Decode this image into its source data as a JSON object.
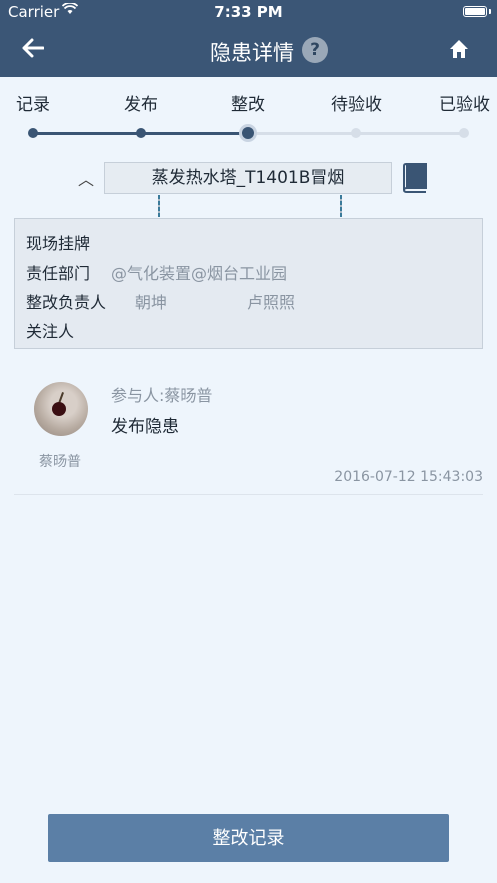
{
  "status_bar": {
    "carrier": "Carrier",
    "time": "7:33 PM"
  },
  "nav": {
    "title": "隐患详情",
    "help_label": "?"
  },
  "progress": {
    "steps": [
      "记录",
      "发布",
      "整改",
      "待验收",
      "已验收"
    ],
    "current_index": 2
  },
  "device": {
    "name": "蒸发热水塔_T1401B冒烟"
  },
  "info": {
    "site_tag_label": "现场挂牌",
    "dept_label": "责任部门",
    "dept_value": "@气化装置@烟台工业园",
    "owner_label": "整改负责人",
    "owner_1": "朝坤",
    "owner_2": "卢照照",
    "follower_label": "关注人"
  },
  "record": {
    "participant": "参与人:蔡旸普",
    "action": "发布隐患",
    "user_name": "蔡旸普",
    "time": "2016-07-12 15:43:03"
  },
  "footer": {
    "button_label": "整改记录"
  },
  "colors": {
    "header": "#3b5676",
    "accent": "#3a5574",
    "button": "#5b7fa6"
  }
}
